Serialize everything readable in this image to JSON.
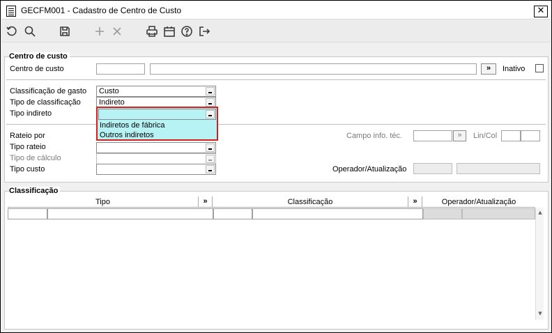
{
  "window": {
    "title": "GECFM001 - Cadastro de Centro de Custo",
    "close_label": "✕"
  },
  "toolbar": {
    "icons": [
      "undo-icon",
      "search-icon",
      "save-icon",
      "add-icon",
      "delete-icon",
      "print-icon",
      "calendar-icon",
      "help-icon",
      "exit-icon"
    ]
  },
  "centro": {
    "group_title": "Centro de custo",
    "centro_label": "Centro de custo",
    "centro_code": "",
    "centro_desc": "",
    "more_label": "»",
    "inativo_label": "Inativo",
    "classificacao_gasto_label": "Classificação de gasto",
    "classificacao_gasto_value": "Custo",
    "tipo_classificacao_label": "Tipo de classificação",
    "tipo_classificacao_value": "Indireto",
    "tipo_indireto_label": "Tipo indireto",
    "tipo_indireto_value": "",
    "tipo_indireto_options": [
      "Indiretos de fábrica",
      "Outros indiretos"
    ],
    "rateio_por_label": "Rateio por",
    "tipo_rateio_label": "Tipo rateio",
    "tipo_calculo_label": "Tipo de cálculo",
    "tipo_custo_label": "Tipo custo",
    "campo_info_label": "Campo info. téc.",
    "campo_info_btn": "»",
    "lincol_label": "Lin/Col",
    "operador_label": "Operador/Atualização"
  },
  "classificacao": {
    "group_title": "Classificação",
    "columns": [
      "Tipo",
      "»",
      "Classificação",
      "»",
      "Operador/Atualização"
    ]
  },
  "colors": {
    "dropdown_bg": "#b7f3f5",
    "dropdown_border": "#d41f1f"
  }
}
